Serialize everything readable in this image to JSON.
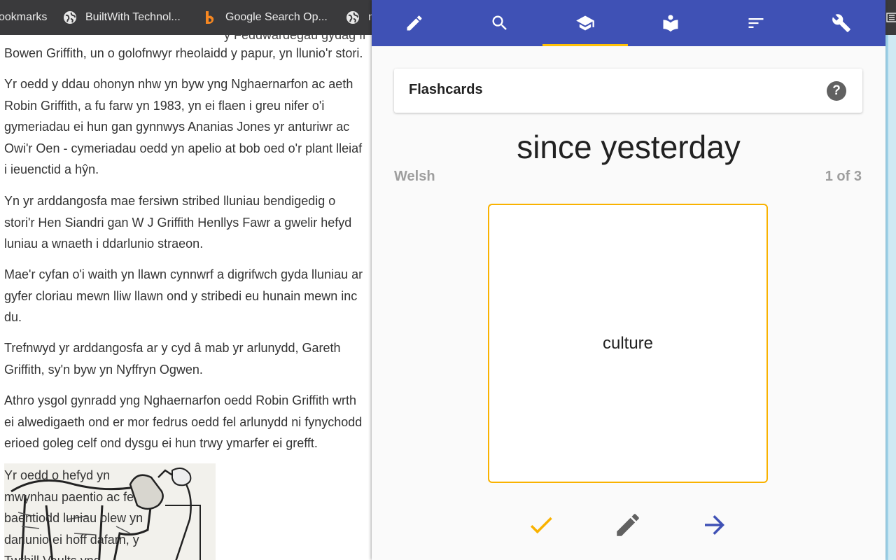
{
  "bookmarks_bar": {
    "items": [
      {
        "label": "ookmarks",
        "icon": "bookmarks-folder"
      },
      {
        "label": "BuiltWith Technol...",
        "icon": "globe-icon"
      },
      {
        "label": "Google Search Op...",
        "icon": "bing-icon"
      },
      {
        "label": "n",
        "icon": "globe-icon"
      }
    ]
  },
  "article": {
    "partial_top_line": "y Feddwardegau gydag ff",
    "paragraphs": [
      "Bowen Griffith, un o golofnwyr rheolaidd y papur, yn llunio'r stori.",
      "Yr oedd y ddau ohonyn nhw yn byw yng Nghaernarfon ac aeth\nRobin Griffith, a fu farw yn 1983, yn ei flaen i greu nifer o'i\ngymeriadau ei hun gan gynnwys Ananias Jones yr anturiwr ac\nOwi'r Oen - cymeriadau oedd yn apelio at bob oed o'r plant lleiaf\ni ieuenctid a hŷn.",
      "Yn yr arddangosfa mae fersiwn stribed lluniau bendigedig o\nstori'r Hen Siandri gan W J Griffith Henllys Fawr a gwelir hefyd\nluniau a wnaeth i ddarlunio straeon.",
      "Mae'r cyfan o'i waith yn llawn cynnwrf a digrifwch gyda lluniau ar\ngyfer cloriau mewn lliw llawn ond y stribedi eu hunain mewn inc\ndu.",
      "Trefnwyd yr arddangosfa ar y cyd â mab yr arlunydd, Gareth\nGriffith, sy'n byw yn Nyffryn Ogwen.",
      "Athro ysgol gynradd yng Nghaernarfon oedd Robin Griffith wrth\nei alwedigaeth ond er mor fedrus oedd fel arlunydd ni fynychodd\nerioed goleg celf ond dysgu ei hun trwy ymarfer ei grefft."
    ],
    "caption": "Yr oedd o hefyd yn\nmwynhau paentio ac fe\nbaentiodd luniau olew yn\ndarlunio ei hoff dafarn, y\nTwthill Vaults yng"
  },
  "popup": {
    "tabs": [
      {
        "name": "tab-edit",
        "icon": "pencil-icon",
        "active": false
      },
      {
        "name": "tab-search",
        "icon": "search-icon",
        "active": false
      },
      {
        "name": "tab-learn",
        "icon": "graduation-cap-icon",
        "active": true
      },
      {
        "name": "tab-study",
        "icon": "reading-book-icon",
        "active": false
      },
      {
        "name": "tab-sort",
        "icon": "sort-icon",
        "active": false
      },
      {
        "name": "tab-settings",
        "icon": "wrench-icon",
        "active": false
      }
    ],
    "header": {
      "title": "Flashcards",
      "help_label": "?"
    },
    "word": "since yesterday",
    "language": "Welsh",
    "counter": "1 of 3",
    "card_text": "culture",
    "actions": [
      {
        "name": "correct-button",
        "icon": "check-icon",
        "color": "#f9b200"
      },
      {
        "name": "edit-card-button",
        "icon": "pencil-icon",
        "color": "#616161"
      },
      {
        "name": "next-card-button",
        "icon": "arrow-right-icon",
        "color": "#3f51b5"
      }
    ]
  },
  "colors": {
    "toolbar": "#3f51b5",
    "accent": "#ffc107",
    "card_border": "#f9b200",
    "bookmarks_bg": "#3a3a3c"
  }
}
